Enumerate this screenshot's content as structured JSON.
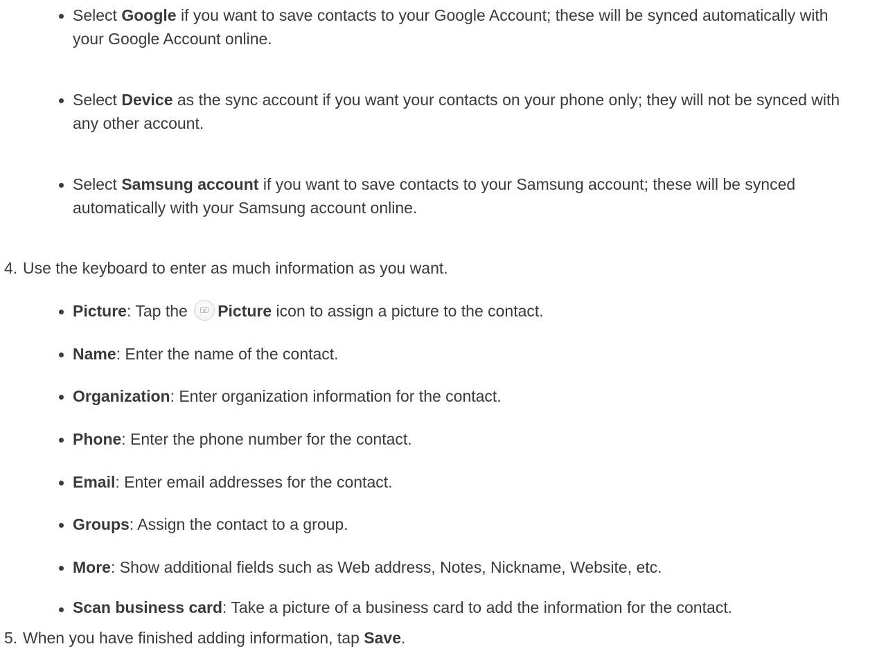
{
  "account_bullets": [
    {
      "prefix": "Select ",
      "bold": "Google",
      "rest": " if you want to save contacts to your Google Account; these will be synced automatically with your Google Account online."
    },
    {
      "prefix": "Select ",
      "bold": "Device",
      "rest": " as the sync account if you want your contacts on your phone only; they will not be synced with any other account."
    },
    {
      "prefix": "Select ",
      "bold": "Samsung account",
      "rest": " if you want to save contacts to your Samsung account; these will be synced automatically with your Samsung account online."
    }
  ],
  "step4": {
    "number": "4.",
    "text": "Use the keyboard to enter as much information as you want."
  },
  "field_bullets": [
    {
      "bold": "Picture",
      "rest_before_icon": ": Tap the ",
      "icon": "picture-icon",
      "icon_label": "Picture",
      "rest": " icon to assign a picture to the contact."
    },
    {
      "bold": "Name",
      "rest": ": Enter the name of the contact."
    },
    {
      "bold": "Organization",
      "rest": ": Enter organization information for the contact."
    },
    {
      "bold": "Phone",
      "rest": ": Enter the phone number for the contact."
    },
    {
      "bold": "Email",
      "rest": ": Enter email addresses for the contact."
    },
    {
      "bold": "Groups",
      "rest": ": Assign the contact to a group."
    },
    {
      "bold": "More",
      "rest": ": Show additional fields such as Web address, Notes, Nickname, Website, etc."
    },
    {
      "bold": "Scan business card",
      "rest": ": Take a picture of a business card to add the information for the contact."
    }
  ],
  "step5": {
    "number": "5.",
    "text": "When you have finished adding information, tap ",
    "bold": "Save",
    "end": "."
  }
}
